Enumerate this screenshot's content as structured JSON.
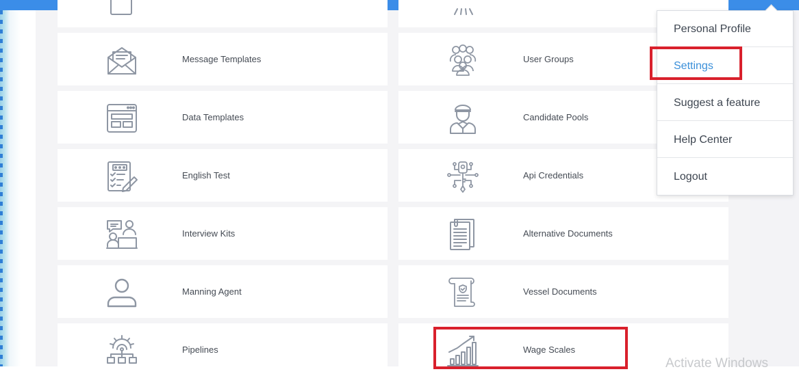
{
  "settings_grid": {
    "left": [
      {
        "label": "Message Templates",
        "icon": "envelope-icon"
      },
      {
        "label": "Data Templates",
        "icon": "browser-window-icon"
      },
      {
        "label": "English Test",
        "icon": "test-checklist-icon"
      },
      {
        "label": "Interview Kits",
        "icon": "interview-icon"
      },
      {
        "label": "Manning Agent",
        "icon": "user-icon"
      },
      {
        "label": "Pipelines",
        "icon": "pipeline-gear-icon"
      }
    ],
    "right": [
      {
        "label": "User Groups",
        "icon": "user-group-icon"
      },
      {
        "label": "Candidate Pools",
        "icon": "sailor-icon"
      },
      {
        "label": "Api Credentials",
        "icon": "key-circuit-icon"
      },
      {
        "label": "Alternative Documents",
        "icon": "documents-icon"
      },
      {
        "label": "Vessel Documents",
        "icon": "certificate-scroll-icon"
      },
      {
        "label": "Wage Scales",
        "icon": "bar-chart-growth-icon"
      }
    ]
  },
  "user_menu": {
    "items": [
      "Personal Profile",
      "Settings",
      "Suggest a feature",
      "Help Center",
      "Logout"
    ],
    "active": "Settings"
  },
  "watermark": "Activate Windows",
  "colors": {
    "topbar": "#3b8de8",
    "highlight": "#d9202c",
    "active_menu": "#3a8fd9",
    "icon_stroke": "#8e96a3",
    "label_text": "#454b54"
  }
}
